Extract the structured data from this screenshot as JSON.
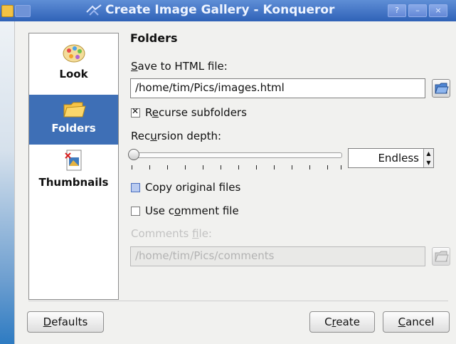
{
  "window": {
    "title": "Create Image Gallery - Konqueror",
    "buttons": [
      "?",
      "–",
      "×"
    ]
  },
  "sidebar": {
    "items": [
      {
        "label": "Look",
        "icon": "palette-icon",
        "active": false
      },
      {
        "label": "Folders",
        "icon": "folder-icon",
        "active": true
      },
      {
        "label": "Thumbnails",
        "icon": "image-file-icon",
        "active": false
      }
    ]
  },
  "page": {
    "heading": "Folders",
    "save_label_pre": "",
    "save_label_u": "S",
    "save_label_post": "ave to HTML file:",
    "save_path": "/home/tim/Pics/images.html",
    "recurse_pre": "R",
    "recurse_u": "e",
    "recurse_post": "curse subfolders",
    "recurse_checked": true,
    "depth_pre": "Rec",
    "depth_u": "u",
    "depth_post": "rsion depth:",
    "depth_value": "Endless",
    "copy_pre": "Copy ori",
    "copy_u": "g",
    "copy_post": "inal files",
    "copy_checked": false,
    "comment_pre": "Use c",
    "comment_u": "o",
    "comment_post": "mment file",
    "comment_checked": false,
    "comments_label_pre": "Comments ",
    "comments_label_u": "f",
    "comments_label_post": "ile:",
    "comments_path": "/home/tim/Pics/comments"
  },
  "footer": {
    "defaults_u": "D",
    "defaults_post": "efaults",
    "create_pre": "C",
    "create_u": "r",
    "create_post": "eate",
    "cancel_u": "C",
    "cancel_post": "ancel"
  },
  "colors": {
    "titlebar": "#3a6dbf",
    "selection": "#3e6fb6",
    "window_bg": "#f1f1ef"
  }
}
